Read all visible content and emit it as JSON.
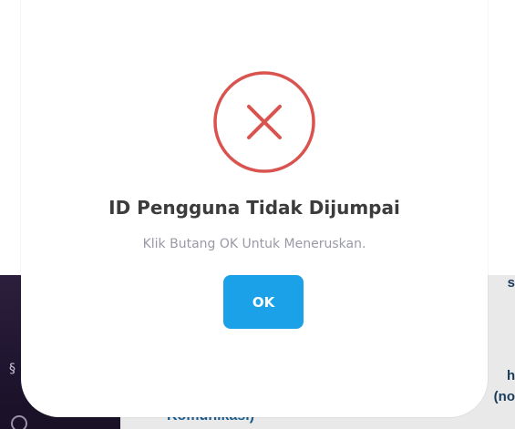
{
  "dialog": {
    "icon": "error-x-circle-icon",
    "title": "ID Pengguna Tidak Dijumpai",
    "text": "Klik Butang OK Untuk Meneruskan.",
    "ok_label": "OK",
    "icon_color": "#d9534f",
    "button_color": "#1ba1e8"
  },
  "background": {
    "heading_fragment": "Komunikasi)",
    "right_fragment_1": "s",
    "right_fragment_2": "h",
    "right_fragment_3": "(no"
  }
}
